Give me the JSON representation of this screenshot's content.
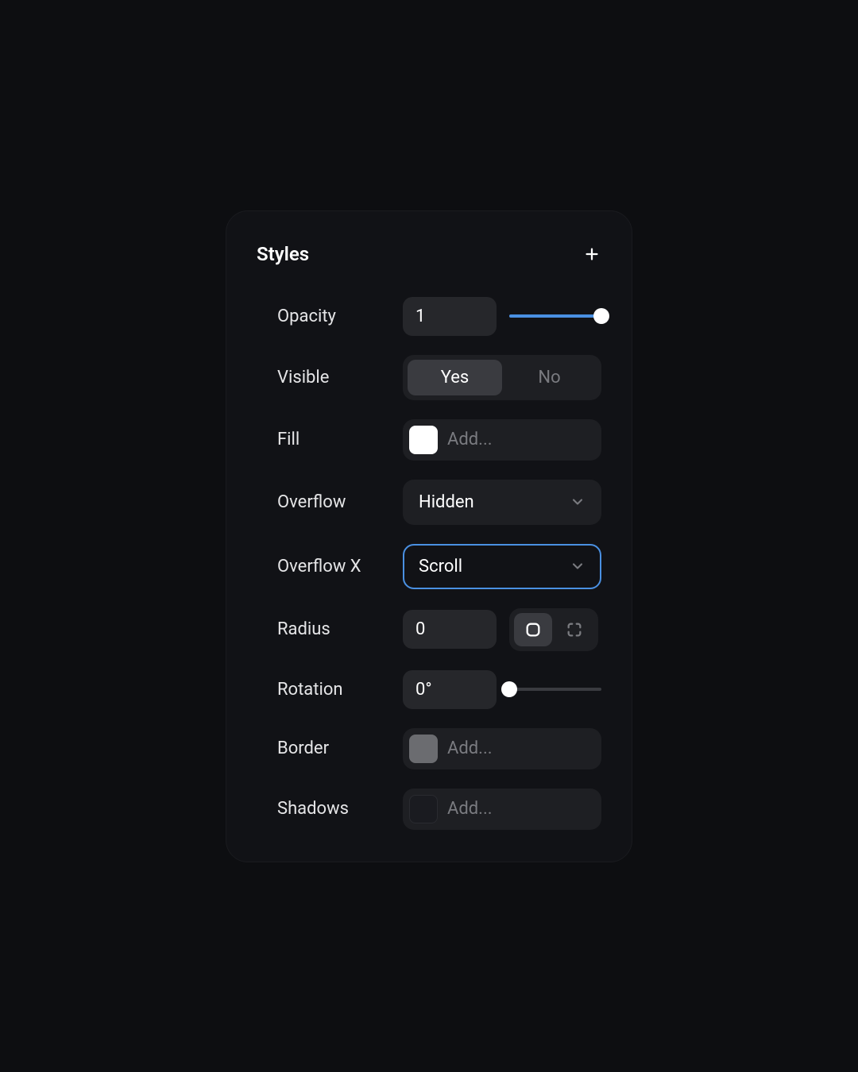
{
  "panel": {
    "title": "Styles"
  },
  "opacity": {
    "label": "Opacity",
    "value": "1",
    "slider_pct": 100
  },
  "visible": {
    "label": "Visible",
    "yes": "Yes",
    "no": "No",
    "value": "Yes"
  },
  "fill": {
    "label": "Fill",
    "placeholder": "Add...",
    "swatch_color": "#ffffff"
  },
  "overflow": {
    "label": "Overflow",
    "value": "Hidden"
  },
  "overflow_x": {
    "label": "Overflow X",
    "value": "Scroll"
  },
  "radius": {
    "label": "Radius",
    "value": "0"
  },
  "rotation": {
    "label": "Rotation",
    "value": "0°",
    "slider_pct": 0
  },
  "border": {
    "label": "Border",
    "placeholder": "Add..."
  },
  "shadows": {
    "label": "Shadows",
    "placeholder": "Add..."
  }
}
